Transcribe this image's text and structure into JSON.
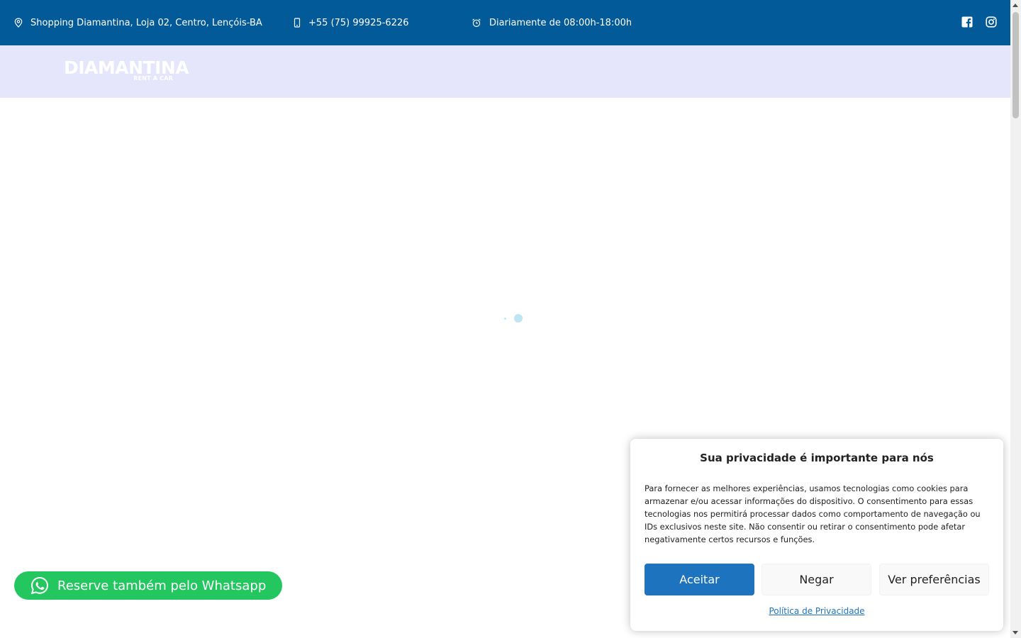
{
  "topbar": {
    "address": "Shopping Diamantina, Loja 02, Centro, Lençóis-BA",
    "phone": "+55 (75) 99925-6226",
    "hours": "Diariamente de 08:00h-18:00h",
    "background": "#035a99"
  },
  "navbar": {
    "background": "#e5e5fc",
    "logo_main": "DIAMANTINA",
    "logo_sub": "RENT A CAR"
  },
  "whatsapp": {
    "label": "Reserve também pelo Whatsapp",
    "color": "#23c65f"
  },
  "cookie": {
    "title": "Sua privacidade é importante para nós",
    "text": "Para fornecer as melhores experiências, usamos tecnologias como cookies para armazenar e/ou acessar informações do dispositivo. O consentimento para essas tecnologias nos permitirá processar dados como comportamento de navegação ou IDs exclusivos neste site. Não consentir ou retirar o consentimento pode afetar negativamente certos recursos e funções.",
    "accept_label": "Aceitar",
    "deny_label": "Negar",
    "prefs_label": "Ver preferências",
    "policy_link": "Política de Privacidade",
    "accent": "#1e73be"
  },
  "icons": {
    "address": "map-pin-icon",
    "phone": "mobile-phone-icon",
    "hours": "alarm-clock-icon",
    "facebook": "facebook-icon",
    "instagram": "instagram-icon",
    "whatsapp": "whatsapp-icon",
    "loader": "loading-spinner"
  }
}
